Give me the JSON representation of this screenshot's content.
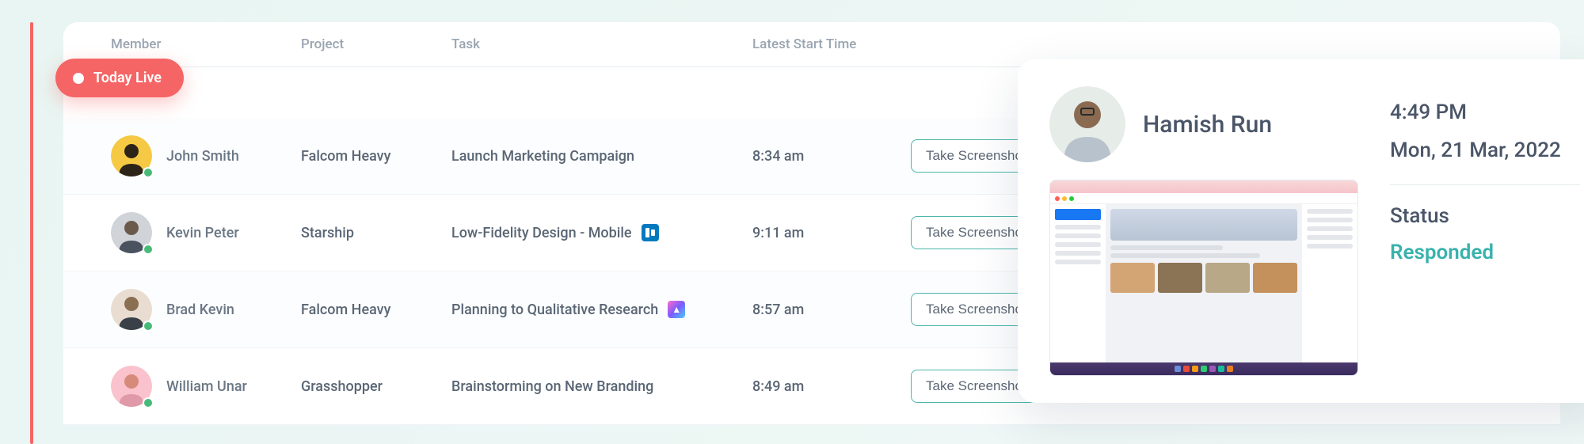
{
  "headers": {
    "member": "Member",
    "project": "Project",
    "task": "Task",
    "time": "Latest Start Time"
  },
  "live_badge": "Today Live",
  "rows": [
    {
      "name": "John Smith",
      "project": "Falcom Heavy",
      "task": "Launch Marketing Campaign",
      "time": "8:34 am",
      "action": "Take Screenshot",
      "avatar_bg": "#f6c944",
      "app_icon": null
    },
    {
      "name": "Kevin Peter",
      "project": "Starship",
      "task": "Low-Fidelity Design - Mobile",
      "time": "9:11 am",
      "action": "Take Screenshot",
      "avatar_bg": "#8a9099",
      "app_icon": "trello"
    },
    {
      "name": "Brad Kevin",
      "project": "Falcom Heavy",
      "task": "Planning to Qualitative Research",
      "time": "8:57 am",
      "action": "Take Screenshot",
      "avatar_bg": "#d8c7b0",
      "app_icon": "clickup"
    },
    {
      "name": "William Unar",
      "project": "Grasshopper",
      "task": "Brainstorming on New Branding",
      "time": "8:49 am",
      "action": "Take Screenshot",
      "avatar_bg": "#f7a8b8",
      "app_icon": null
    }
  ],
  "detail": {
    "name": "Hamish Run",
    "time": "4:49 PM",
    "date": "Mon, 21 Mar, 2022",
    "status_label": "Status",
    "status_value": "Responded"
  }
}
